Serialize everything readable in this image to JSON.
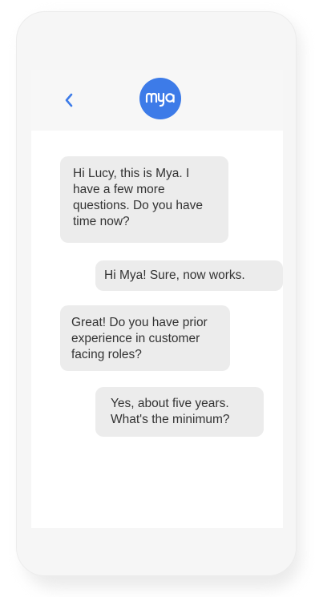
{
  "header": {
    "back_icon": "chevron-left-icon",
    "avatar_text": "mya",
    "accent_color": "#3d7be8"
  },
  "messages": [
    {
      "sender": "bot",
      "text": "Hi Lucy, this is Mya. I\nhave a few more\nquestions. Do you have\ntime now?"
    },
    {
      "sender": "user",
      "text": "Hi Mya! Sure, now works."
    },
    {
      "sender": "bot",
      "text": "Great! Do you have prior\nexperience in customer\nfacing roles?"
    },
    {
      "sender": "user",
      "text": "Yes, about five years.\nWhat's the minimum?"
    }
  ],
  "colors": {
    "bubble": "#ececec",
    "text": "#333333",
    "back_icon": "#3d7be8"
  }
}
